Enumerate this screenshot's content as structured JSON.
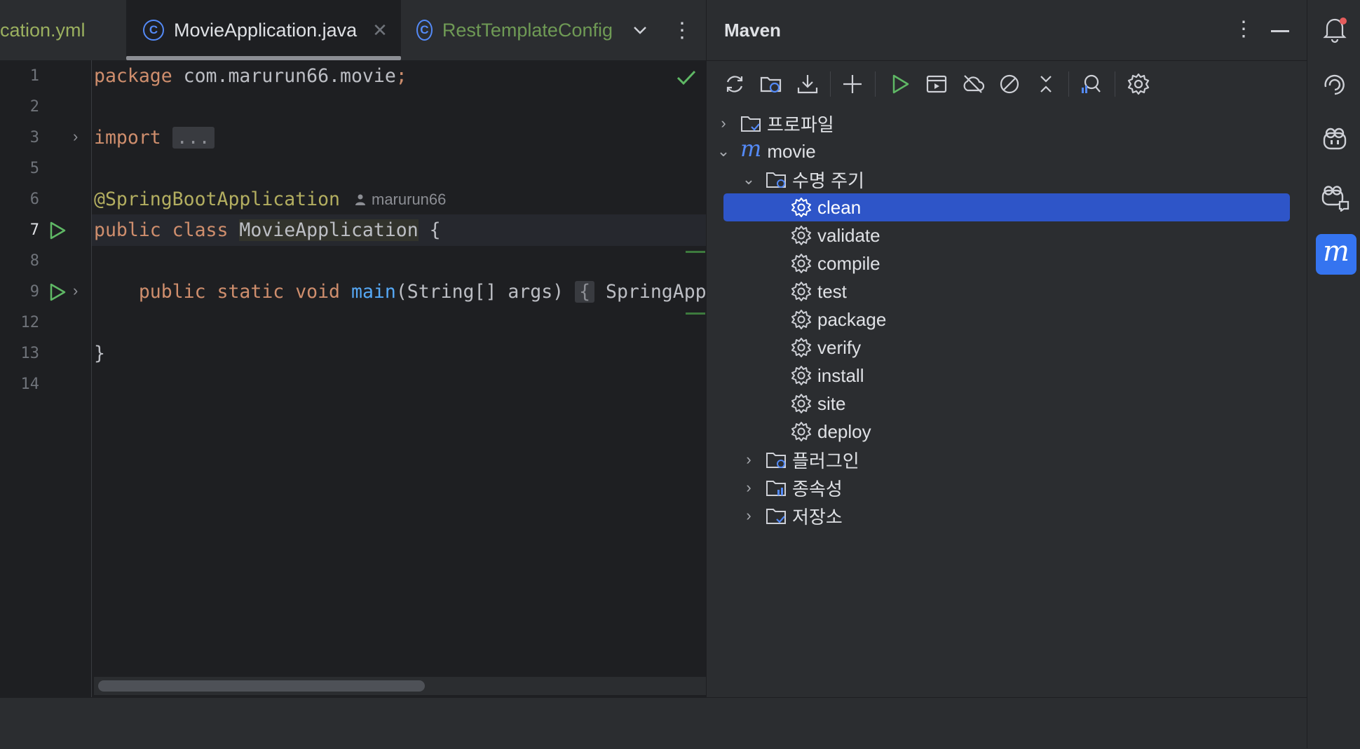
{
  "tabs": [
    {
      "label": "cation.yml",
      "color": "#9bb05f"
    },
    {
      "label": "MovieApplication.java",
      "active": true
    },
    {
      "label": "RestTemplateConfig",
      "color": "#6f9a55"
    }
  ],
  "tab_icon_letter": "C",
  "code": {
    "line_numbers": [
      "1",
      "2",
      "3",
      "5",
      "6",
      "7",
      "8",
      "9",
      "12",
      "13",
      "14"
    ],
    "line1_kw": "package",
    "line1_rest": " com.marurun66.movie",
    "line1_semi": ";",
    "line3_kw": "import",
    "line3_fold": "...",
    "line6_ann": "@SpringBootApplication",
    "line6_author": "marurun66",
    "line7_kw": "public class",
    "line7_name": "MovieApplication",
    "line7_brace": " {",
    "line9_kw": "public static void",
    "line9_fn": "main",
    "line9_args": "(String[] args) ",
    "line9_fold": "{",
    "line9_rest": " SpringAppli",
    "line13": "}"
  },
  "maven": {
    "title": "Maven",
    "tree": {
      "profiles": "프로파일",
      "project": "movie",
      "lifecycle": "수명 주기",
      "phases": [
        "clean",
        "validate",
        "compile",
        "test",
        "package",
        "verify",
        "install",
        "site",
        "deploy"
      ],
      "plugins": "플러그인",
      "dependencies": "종속성",
      "repositories": "저장소"
    },
    "selected": "clean"
  },
  "colors": {
    "accent": "#548af7",
    "selection": "#2e55c8",
    "run_green": "#5fb865"
  }
}
